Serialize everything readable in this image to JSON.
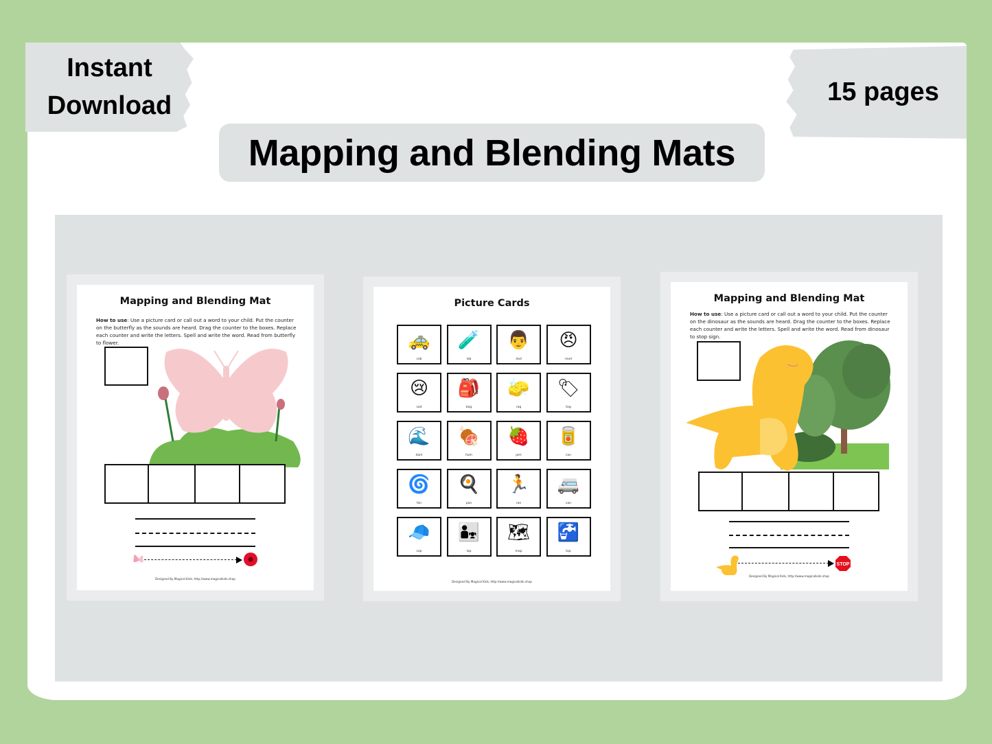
{
  "banner": {
    "left_badge_line1": "Instant",
    "left_badge_line2": "Download",
    "right_badge": "15 pages",
    "title": "Mapping and Blending Mats"
  },
  "colors": {
    "background_green": "#b1d49c",
    "panel_gray": "#dfe2e3",
    "white": "#ffffff"
  },
  "pages": [
    {
      "title": "Mapping and Blending Mat",
      "how_to_label": "How to use",
      "how_to_text": ": Use a picture card or call out a word to your child. Put the counter on the butterfly as the sounds are heard. Drag the counter to the boxes. Replace each counter and write the letters. Spell and write the word. Read from butterfly to flower.",
      "start_icon": "butterfly-icon",
      "end_icon": "flower-icon",
      "footer": "Designed By Magical Kids, http://www.magicalkids.shop"
    },
    {
      "title": "Picture Cards",
      "cards": [
        {
          "word": "cab",
          "icon": "🚕"
        },
        {
          "word": "lab",
          "icon": "🧪"
        },
        {
          "word": "dad",
          "icon": "👨"
        },
        {
          "word": "mad",
          "icon": "😠"
        },
        {
          "word": "sad",
          "icon": "😢"
        },
        {
          "word": "bag",
          "icon": "🎒"
        },
        {
          "word": "rag",
          "icon": "🧽"
        },
        {
          "word": "tag",
          "icon": "🏷"
        },
        {
          "word": "dam",
          "icon": "🌊"
        },
        {
          "word": "ham",
          "icon": "🍖"
        },
        {
          "word": "jam",
          "icon": "🍓"
        },
        {
          "word": "can",
          "icon": "🥫"
        },
        {
          "word": "fan",
          "icon": "🌀"
        },
        {
          "word": "pan",
          "icon": "🍳"
        },
        {
          "word": "ran",
          "icon": "🏃"
        },
        {
          "word": "van",
          "icon": "🚐"
        },
        {
          "word": "cap",
          "icon": "🧢"
        },
        {
          "word": "lap",
          "icon": "👨‍👧"
        },
        {
          "word": "map",
          "icon": "🗺"
        },
        {
          "word": "tap",
          "icon": "🚰"
        }
      ],
      "footer": "Designed By Magical Kids, http://www.magicalkids.shop"
    },
    {
      "title": "Mapping and Blending Mat",
      "how_to_label": "How to use",
      "how_to_text": ": Use a picture card or call out a word to your child. Put the counter on the dinosaur as the sounds are heard. Drag the counter to the boxes. Replace each counter and write the letters. Spell and write the word. Read from dinosaur to stop sign.",
      "start_icon": "dinosaur-icon",
      "end_icon": "stop-sign-icon",
      "stop_text": "STOP",
      "footer": "Designed By Magical Kids, http://www.magicalkids.shop"
    }
  ]
}
